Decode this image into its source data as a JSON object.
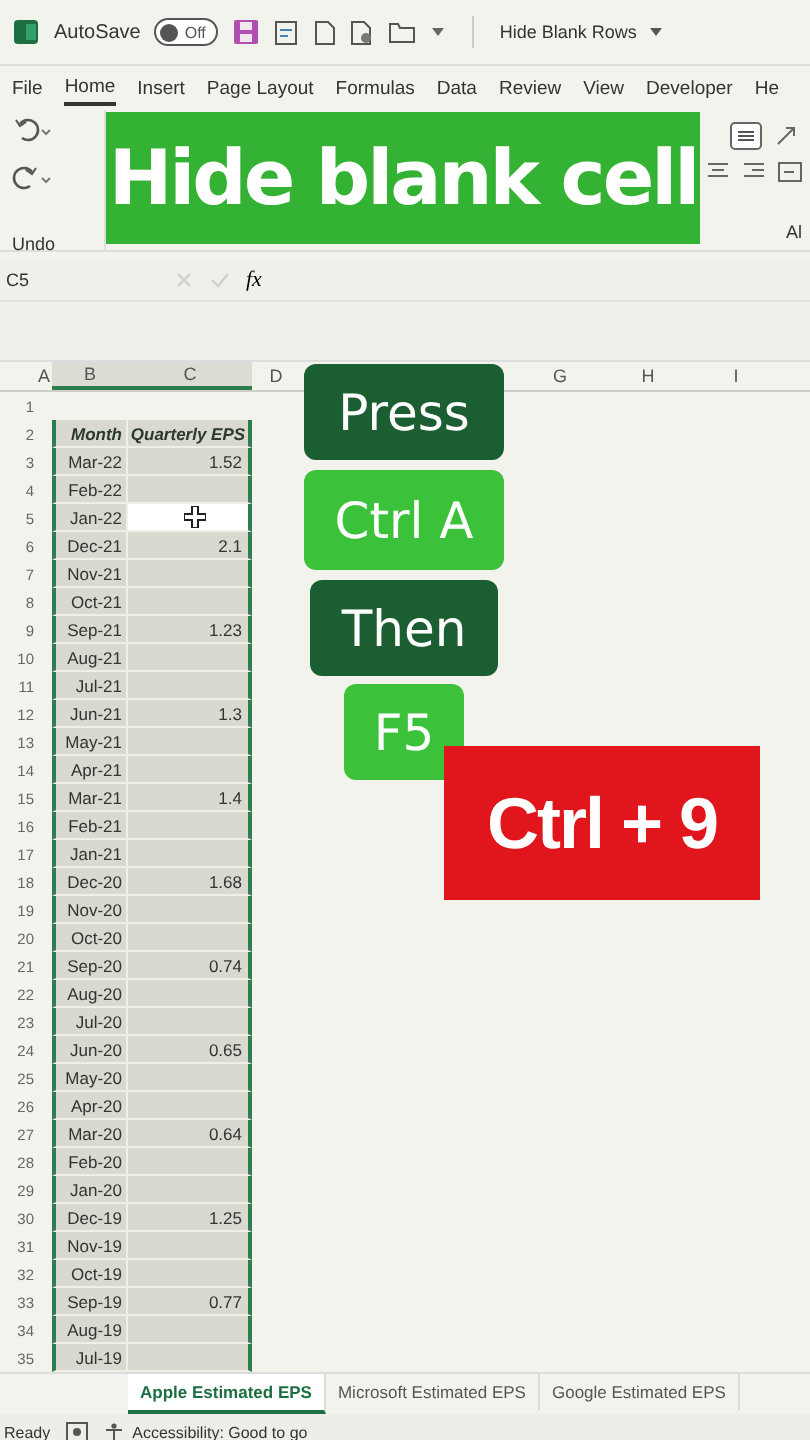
{
  "title_bar": {
    "autosave_label": "AutoSave",
    "autosave": {
      "on": false,
      "label": "Off"
    },
    "document_title": "Hide Blank Rows"
  },
  "menu_tabs": [
    {
      "label": "File",
      "selected": false
    },
    {
      "label": "Home",
      "selected": true
    },
    {
      "label": "Insert",
      "selected": false
    },
    {
      "label": "Page Layout",
      "selected": false
    },
    {
      "label": "Formulas",
      "selected": false
    },
    {
      "label": "Data",
      "selected": false
    },
    {
      "label": "Review",
      "selected": false
    },
    {
      "label": "View",
      "selected": false
    },
    {
      "label": "Developer",
      "selected": false
    },
    {
      "label": "He",
      "selected": false
    }
  ],
  "ribbon": {
    "group_label": "Undo",
    "cut_label": "Al"
  },
  "formula_bar": {
    "name_box": "C5",
    "function_label": "fx"
  },
  "columns_left": [
    "A",
    "B",
    "C",
    "D"
  ],
  "columns_right": [
    "G",
    "H",
    "I"
  ],
  "table": {
    "first_row": "1",
    "header_row": "2",
    "header": [
      "Month",
      "Quarterly EPS"
    ],
    "rows": [
      {
        "row": "3",
        "month": "Mar-22",
        "eps": "1.52",
        "selected": false
      },
      {
        "row": "4",
        "month": "Feb-22",
        "selected": false
      },
      {
        "row": "5",
        "month": "Jan-22",
        "selected": true
      },
      {
        "row": "6",
        "month": "Dec-21",
        "eps": "2.1",
        "selected": false
      },
      {
        "row": "7",
        "month": "Nov-21",
        "selected": false
      },
      {
        "row": "8",
        "month": "Oct-21",
        "selected": false
      },
      {
        "row": "9",
        "month": "Sep-21",
        "eps": "1.23",
        "selected": false
      },
      {
        "row": "10",
        "month": "Aug-21",
        "selected": false
      },
      {
        "row": "11",
        "month": "Jul-21",
        "selected": false
      },
      {
        "row": "12",
        "month": "Jun-21",
        "eps": "1.3",
        "selected": false
      },
      {
        "row": "13",
        "month": "May-21",
        "selected": false
      },
      {
        "row": "14",
        "month": "Apr-21",
        "selected": false
      },
      {
        "row": "15",
        "month": "Mar-21",
        "eps": "1.4",
        "selected": false
      },
      {
        "row": "16",
        "month": "Feb-21",
        "selected": false
      },
      {
        "row": "17",
        "month": "Jan-21",
        "selected": false
      },
      {
        "row": "18",
        "month": "Dec-20",
        "eps": "1.68",
        "selected": false
      },
      {
        "row": "19",
        "month": "Nov-20",
        "selected": false
      },
      {
        "row": "20",
        "month": "Oct-20",
        "selected": false
      },
      {
        "row": "21",
        "month": "Sep-20",
        "eps": "0.74",
        "selected": false
      },
      {
        "row": "22",
        "month": "Aug-20",
        "selected": false
      },
      {
        "row": "23",
        "month": "Jul-20",
        "selected": false
      },
      {
        "row": "24",
        "month": "Jun-20",
        "eps": "0.65",
        "selected": false
      },
      {
        "row": "25",
        "month": "May-20",
        "selected": false
      },
      {
        "row": "26",
        "month": "Apr-20",
        "selected": false
      },
      {
        "row": "27",
        "month": "Mar-20",
        "eps": "0.64",
        "selected": false
      },
      {
        "row": "28",
        "month": "Feb-20",
        "selected": false
      },
      {
        "row": "29",
        "month": "Jan-20",
        "selected": false
      },
      {
        "row": "30",
        "month": "Dec-19",
        "eps": "1.25",
        "selected": false
      },
      {
        "row": "31",
        "month": "Nov-19",
        "selected": false
      },
      {
        "row": "32",
        "month": "Oct-19",
        "selected": false
      },
      {
        "row": "33",
        "month": "Sep-19",
        "eps": "0.77",
        "selected": false
      },
      {
        "row": "34",
        "month": "Aug-19",
        "selected": false
      },
      {
        "row": "35",
        "month": "Jul-19",
        "selected": false
      }
    ]
  },
  "overlays": [
    {
      "text": "Hide blank cell",
      "kind": "banner"
    },
    {
      "text": "Press",
      "kind": "dark"
    },
    {
      "text": "Ctrl A",
      "kind": "light"
    },
    {
      "text": "Then",
      "kind": "dark"
    },
    {
      "text": "F5",
      "kind": "light"
    },
    {
      "text": "Ctrl + 9",
      "kind": "red"
    }
  ],
  "sheet_tabs": [
    {
      "label": "Apple Estimated EPS",
      "selected": true
    },
    {
      "label": "Microsoft Estimated EPS",
      "selected": false
    },
    {
      "label": "Google Estimated EPS",
      "selected": false
    }
  ],
  "status_bar": {
    "mode": "Ready",
    "accessibility": "Accessibility: Good to go"
  }
}
